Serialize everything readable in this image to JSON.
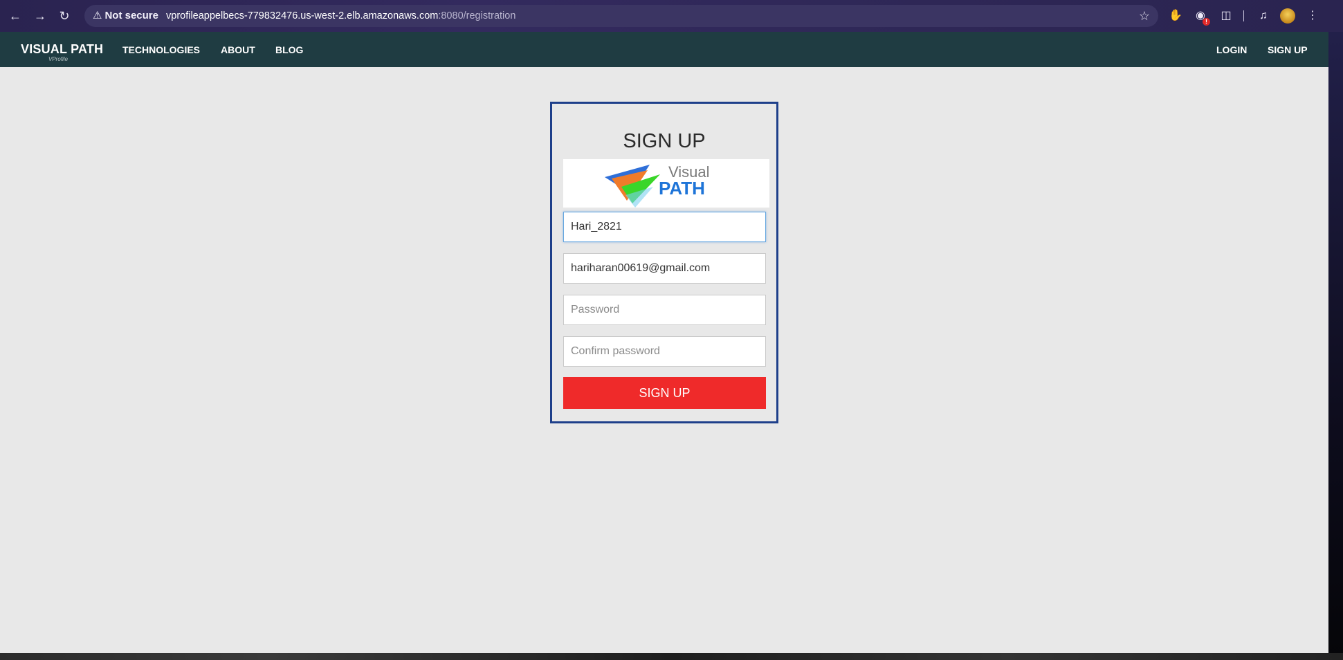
{
  "browser": {
    "security_label": "Not secure",
    "url_host": "vprofileappelbecs-779832476.us-west-2.elb.amazonaws.com",
    "url_path": ":8080/registration"
  },
  "navbar": {
    "brand": "VISUAL PATH",
    "brand_sub": "VProfile",
    "links": [
      "TECHNOLOGIES",
      "ABOUT",
      "BLOG"
    ],
    "login": "LOGIN",
    "signup": "SIGN UP"
  },
  "form": {
    "title": "SIGN UP",
    "logo": {
      "word1": "Visual",
      "word2": "PATH"
    },
    "username_value": "Hari_2821",
    "email_value": "hariharan00619@gmail.com",
    "password_placeholder": "Password",
    "confirm_placeholder": "Confirm password",
    "submit_label": "SIGN UP"
  },
  "colors": {
    "navbar_bg": "#1f3c42",
    "card_border": "#1e3f8a",
    "submit_bg": "#ef2a2a",
    "page_bg": "#e8e8e8"
  }
}
